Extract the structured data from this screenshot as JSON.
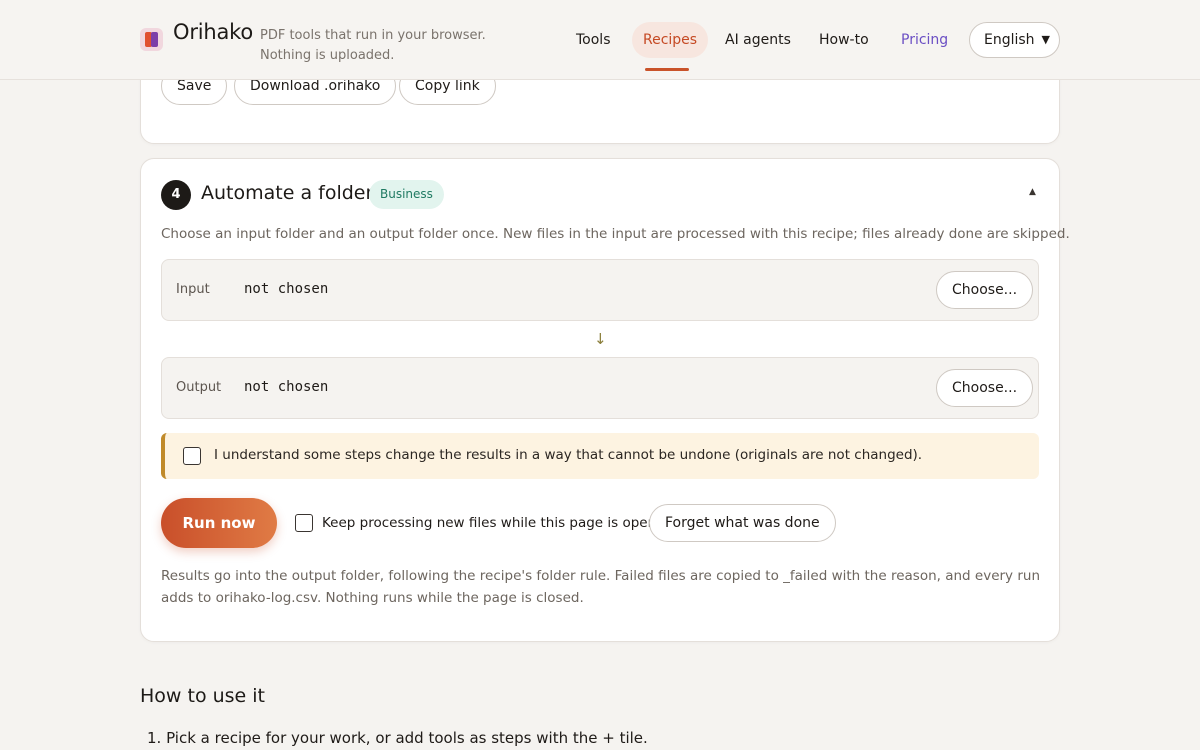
{
  "header": {
    "brand": "Orihako",
    "tagline": "PDF tools that run in your browser. Nothing is uploaded.",
    "nav": {
      "tools": "Tools",
      "recipes": "Recipes",
      "ai_agents": "AI agents",
      "how_to": "How-to",
      "pricing": "Pricing"
    },
    "language": "English",
    "active_nav": "Recipes"
  },
  "recipe_card": {
    "buttons": {
      "save": "Save",
      "download": "Download .orihako",
      "copy_link": "Copy link"
    }
  },
  "automate": {
    "step_number": "4",
    "title": "Automate a folder",
    "badge": "Business",
    "description": "Choose an input folder and an output folder once. New files in the input are processed with this recipe; files already done are skipped.",
    "input": {
      "label": "Input",
      "value": "not chosen",
      "button": "Choose..."
    },
    "arrow": "↓",
    "output": {
      "label": "Output",
      "value": "not chosen",
      "button": "Choose..."
    },
    "acknowledge": {
      "checked": false,
      "text": "I understand some steps change the results in a way that cannot be undone (originals are not changed)."
    },
    "run_button": "Run now",
    "keep_processing": {
      "checked": false,
      "text": "Keep processing new files while this page is open"
    },
    "forget_button": "Forget what was done",
    "results_note": "Results go into the output folder, following the recipe's folder rule. Failed files are copied to _failed with the reason, and every run adds to orihako-log.csv. Nothing runs while the page is closed."
  },
  "how_to_use": {
    "title": "How to use it",
    "steps": [
      "1. Pick a recipe for your work, or add tools as steps with the + tile."
    ]
  },
  "colors": {
    "accent": "#c94f2a",
    "accent_light": "#e07b45",
    "pricing": "#6b4fc4",
    "badge_bg": "#e2f4ee",
    "badge_text": "#1f7a62",
    "warning_bg": "#fdf3e1",
    "warning_border": "#c08a2a"
  },
  "icons": {
    "logo": "orihako-logo-icon",
    "collapse": "caret-up-icon",
    "language": "chevron-down-icon",
    "flow": "arrow-down-icon"
  }
}
